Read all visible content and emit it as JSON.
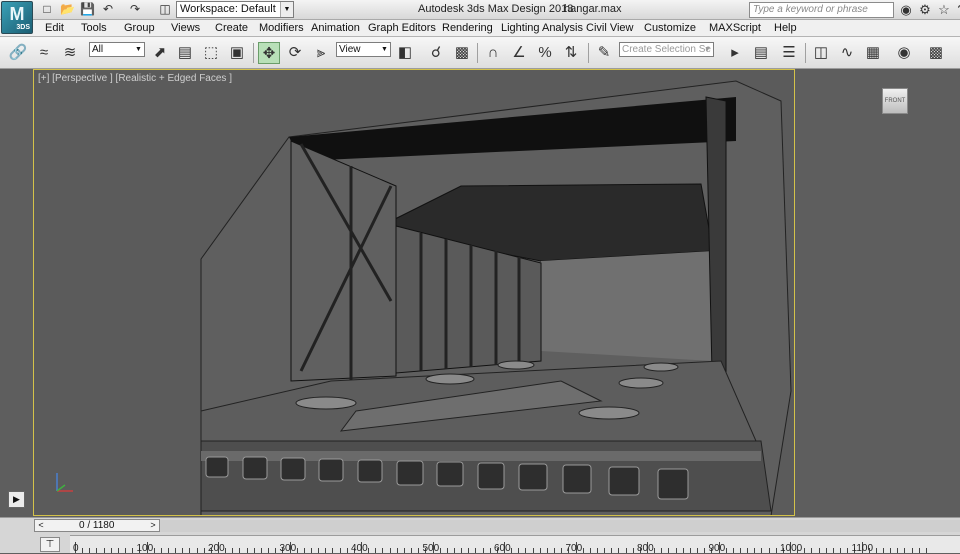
{
  "app": {
    "title": "Autodesk 3ds Max Design 2013",
    "filename": "hangar.max",
    "logo_text": "3DS"
  },
  "quick_access": {
    "icons": [
      "new-file-icon",
      "open-file-icon",
      "save-file-icon",
      "undo-icon",
      "redo-icon",
      "project-folder-icon"
    ],
    "workspace_label": "Workspace: Default"
  },
  "search": {
    "placeholder": "Type a keyword or phrase"
  },
  "title_icons": [
    "binoculars-icon",
    "tools-icon",
    "star-icon",
    "help-icon"
  ],
  "menu": [
    "Edit",
    "Tools",
    "Group",
    "Views",
    "Create",
    "Modifiers",
    "Animation",
    "Graph Editors",
    "Rendering",
    "Lighting Analysis",
    "Civil View",
    "Customize",
    "MAXScript",
    "Help"
  ],
  "toolbar": {
    "filter_value": "All",
    "refcoord_value": "View",
    "selection_set_placeholder": "Create Selection Se",
    "active_tool": "select-and-move"
  },
  "viewport": {
    "label": "[+] [Perspective ] [Realistic + Edged Faces ]",
    "viewcube_label": "FRONT"
  },
  "timeline": {
    "slider_label": "0 / 1180",
    "ruler_labels": [
      "0",
      "100",
      "200",
      "300",
      "400",
      "500",
      "600",
      "700",
      "800",
      "900",
      "1000",
      "1100"
    ]
  },
  "colors": {
    "viewport_border": "#d4c24a",
    "active_tool": "#b8e0b8"
  }
}
